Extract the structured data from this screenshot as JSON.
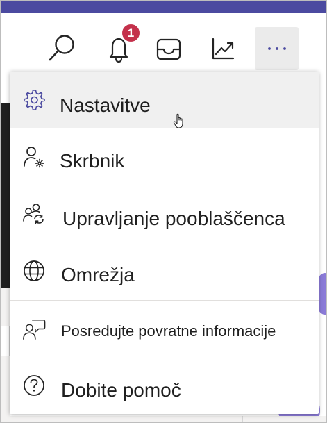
{
  "toolbar": {
    "buttons": [
      {
        "icon": "search-icon"
      },
      {
        "icon": "bell-icon",
        "badge": "1"
      },
      {
        "icon": "inbox-icon"
      },
      {
        "icon": "trending-chart-icon"
      },
      {
        "icon": "more-options-icon",
        "label": "···"
      }
    ]
  },
  "menu": {
    "items": [
      {
        "label": "Nastavitve",
        "icon": "gear-icon",
        "highlighted": true
      },
      {
        "label": "Skrbnik",
        "icon": "admin-user-gear-icon"
      },
      {
        "label": "Upravljanje pooblaščenca",
        "icon": "manage-delegate-icon"
      },
      {
        "label": "Omrežja",
        "icon": "globe-icon"
      },
      {
        "label": "Posredujte povratne informacije",
        "icon": "feedback-icon"
      },
      {
        "label": "Dobite pomoč",
        "icon": "help-icon"
      }
    ]
  },
  "colors": {
    "accent": "#4b4aa0",
    "badge": "#c4314b",
    "highlight": "#f0f0f0",
    "more_button_bg": "#ebebeb"
  }
}
